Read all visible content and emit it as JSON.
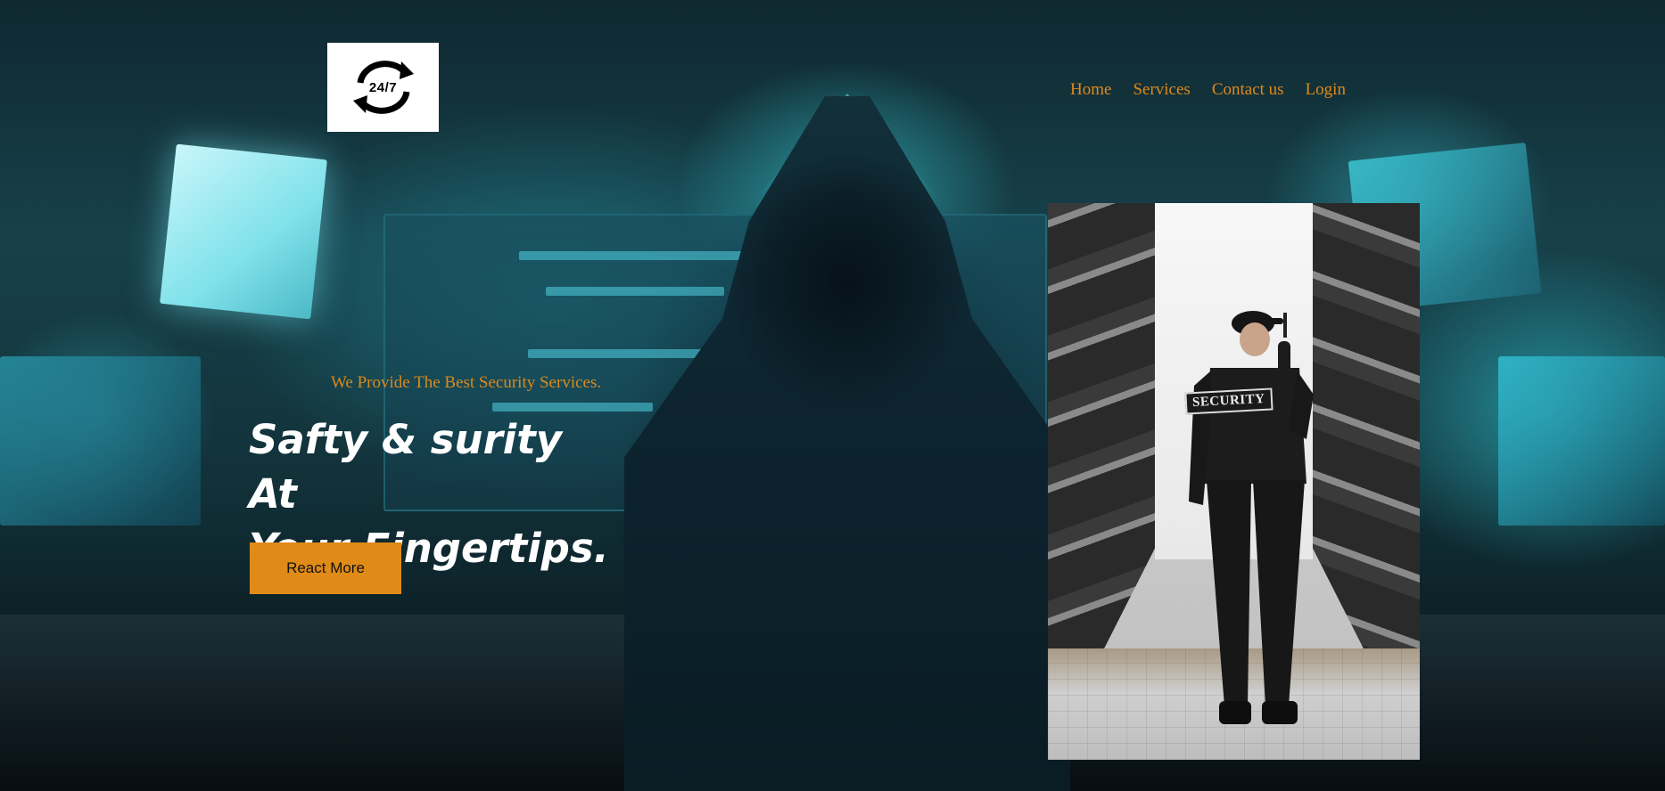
{
  "brand": {
    "logo_text": "24/7",
    "logo_icon": "refresh-cycle-icon"
  },
  "nav": {
    "items": [
      {
        "label": "Home"
      },
      {
        "label": "Services"
      },
      {
        "label": "Contact us"
      },
      {
        "label": "Login"
      }
    ]
  },
  "hero": {
    "tagline": "We Provide The Best Security Services.",
    "headline_line1": "Safty & surity At",
    "headline_line2": "Your Fingertips.",
    "cta_label": "React More"
  },
  "photo": {
    "badge_text": "SECURITY"
  },
  "colors": {
    "accent": "#e08a17",
    "nav_text": "#e0881a",
    "headline": "#ffffff"
  }
}
